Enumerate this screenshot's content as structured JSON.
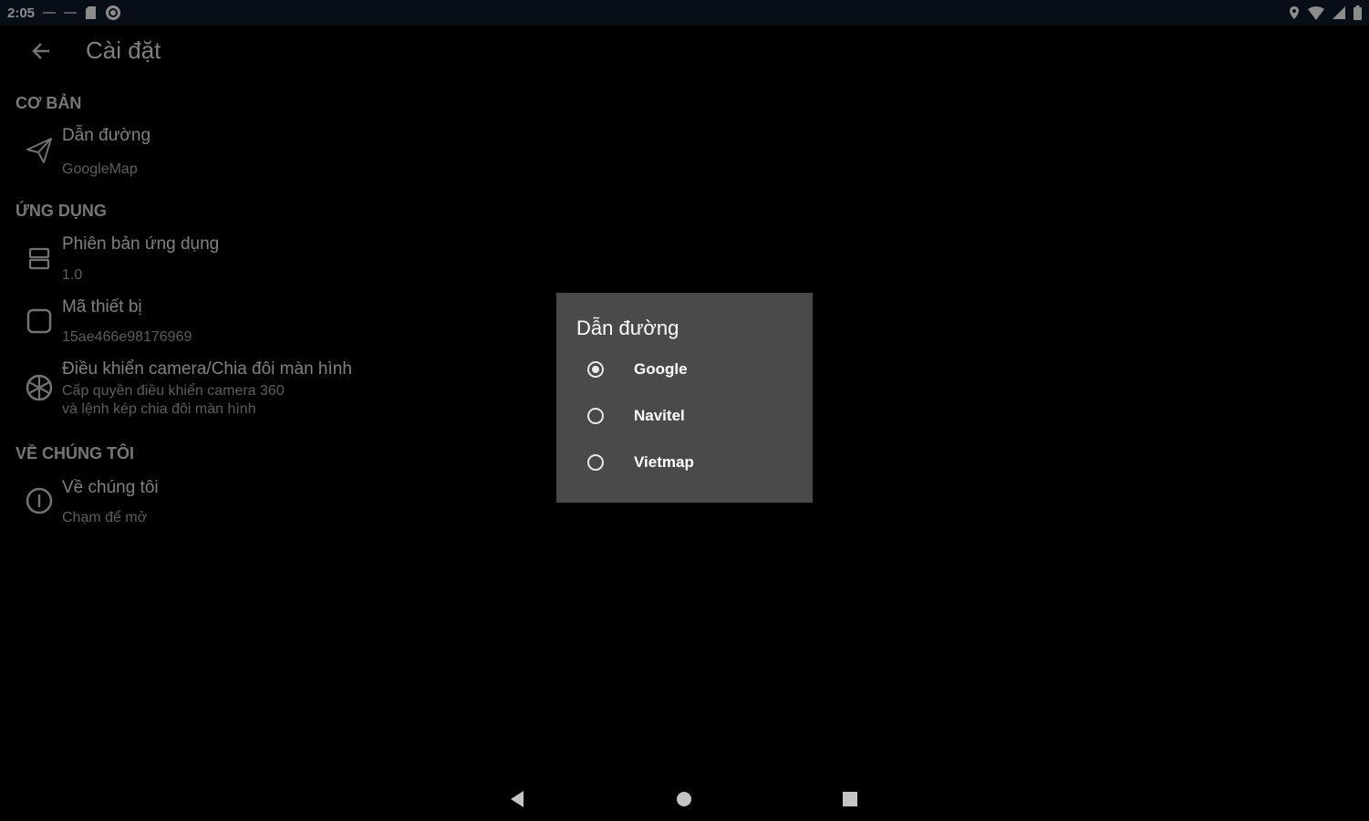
{
  "status_bar": {
    "time": "2:05"
  },
  "app_bar": {
    "title": "Cài đặt"
  },
  "sections": {
    "basic": {
      "header": "CƠ BẢN",
      "navigation": {
        "title": "Dẫn đường",
        "summary": "GoogleMap"
      }
    },
    "app": {
      "header": "ỨNG DỤNG",
      "version": {
        "title": "Phiên bản ứng dụng",
        "summary": "1.0"
      },
      "device_id": {
        "title": "Mã thiết bị",
        "summary": "15ae466e98176969"
      },
      "camera": {
        "title": "Điều khiển camera/Chia đôi màn hình",
        "summary_line1": "Cấp quyền điều khiển camera 360",
        "summary_line2": "và lệnh kép chia đôi màn hình"
      }
    },
    "about": {
      "header": "VỀ CHÚNG TÔI",
      "about_us": {
        "title": "Về chúng tôi",
        "summary": "Chạm để mở"
      }
    }
  },
  "dialog": {
    "title": "Dẫn đường",
    "options": [
      {
        "label": "Google",
        "selected": true
      },
      {
        "label": "Navitel",
        "selected": false
      },
      {
        "label": "Vietmap",
        "selected": false
      }
    ]
  },
  "colors": {
    "status_bar_bg": "#0f1a2b",
    "dialog_bg": "#4a4a4a"
  }
}
